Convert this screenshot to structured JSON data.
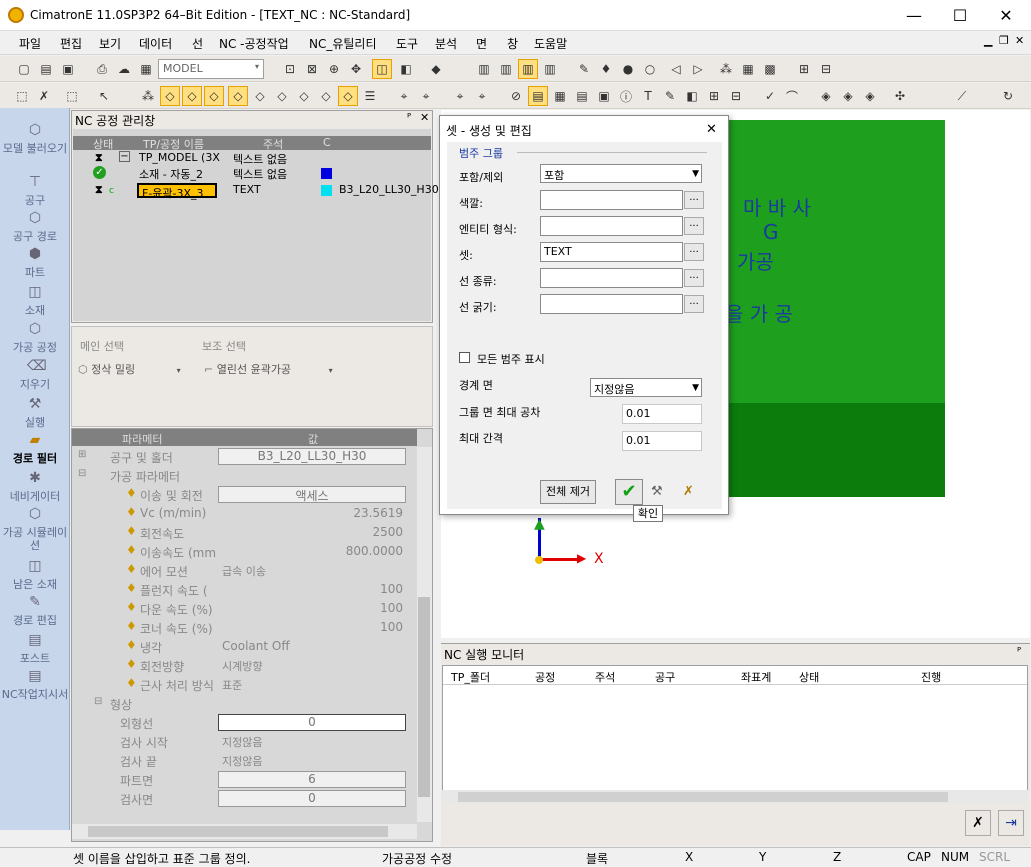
{
  "window": {
    "title": "CimatronE 11.0SP3P2 64–Bit Edition - [TEXT_NC : NC-Standard]",
    "minimize": "—",
    "maximize": "☐",
    "close": "✕"
  },
  "menu": [
    "파일",
    "편집",
    "보기",
    "데이터",
    "선",
    "NC -공정작업",
    "NC_유틸리티",
    "도구",
    "분석",
    "면",
    "창",
    "도움말"
  ],
  "toolbar": {
    "model_combo": "MODEL"
  },
  "sidebar": [
    {
      "label": "모델 불러오기",
      "icon": "model-load-icon"
    },
    {
      "label": "공구",
      "icon": "tool-icon"
    },
    {
      "label": "공구 경로",
      "icon": "toolpath-icon"
    },
    {
      "label": "파트",
      "icon": "part-icon"
    },
    {
      "label": "소재",
      "icon": "stock-icon"
    },
    {
      "label": "가공 공정",
      "icon": "process-icon"
    },
    {
      "label": "지우기",
      "icon": "erase-icon"
    },
    {
      "label": "실행",
      "icon": "run-icon"
    },
    {
      "label": "경로 필터",
      "icon": "path-filter-icon"
    },
    {
      "label": "네비게이터",
      "icon": "navigator-icon"
    },
    {
      "label": "가공 시뮬레이션",
      "icon": "simulation-icon"
    },
    {
      "label": "남은 소재",
      "icon": "remaining-stock-icon"
    },
    {
      "label": "경로 편집",
      "icon": "path-edit-icon"
    },
    {
      "label": "포스트",
      "icon": "post-icon"
    },
    {
      "label": "NC작업지시서",
      "icon": "nc-sheet-icon"
    }
  ],
  "nc_manager": {
    "title": "NC 공정 관리창",
    "pin": "ᴾ",
    "close": "✕",
    "columns": [
      "상태",
      "TP/공정 이름",
      "주석",
      "C"
    ],
    "rows": [
      {
        "name": "TP_MODEL (3X",
        "comment": "텍스트 없음",
        "extra": ""
      },
      {
        "name": "소재 - 자동_2",
        "comment": "텍스트 없음",
        "extra": ""
      },
      {
        "name": "F-윤곽-3X_3",
        "comment": "TEXT",
        "extra": "B3_L20_LL30_H30"
      }
    ],
    "status_c": "c"
  },
  "selection": {
    "main_label": "메인 선택",
    "sub_label": "보조 선택",
    "main_value": "정삭 밀링",
    "sub_value": "열린선 윤곽가공"
  },
  "params": {
    "col_param": "파라메터",
    "col_value": "값",
    "tool_holder": "공구 및 홀더",
    "tool_value": "B3_L20_LL30_H30",
    "machining": "가공 파라메터",
    "rows": [
      {
        "name": "이송 및 회전",
        "value": "액세스"
      },
      {
        "name": "Vc (m/min)",
        "value": "23.5619"
      },
      {
        "name": "회전속도",
        "value": "2500"
      },
      {
        "name": "이송속도 (mm",
        "value": "800.0000"
      },
      {
        "name": "에어 모션",
        "value": "급속 이송"
      },
      {
        "name": "플런지 속도 (",
        "value": "100"
      },
      {
        "name": "다운 속도 (%)",
        "value": "100"
      },
      {
        "name": "코너 속도 (%)",
        "value": "100"
      },
      {
        "name": "냉각",
        "value": "Coolant Off"
      },
      {
        "name": "회전방향",
        "value": "시계방향"
      },
      {
        "name": "근사 처리 방식",
        "value": "표준"
      }
    ],
    "shape": "형상",
    "shape_rows": [
      {
        "name": "외형선",
        "value": "0"
      },
      {
        "name": "검사 시작",
        "value": "지정않음"
      },
      {
        "name": "검사 끝",
        "value": "지정않음"
      },
      {
        "name": "파트면",
        "value": "6"
      },
      {
        "name": "검사면",
        "value": "0"
      }
    ]
  },
  "dialog": {
    "title": "셋 - 생성 및 편집",
    "close": "✕",
    "group": "범주 그룹",
    "include_label": "포함/제외",
    "include_value": "포함",
    "color_label": "색깔:",
    "entity_label": "엔티티 형식:",
    "set_label": "셋:",
    "set_value": "TEXT",
    "linetype_label": "선 종류:",
    "linewidth_label": "선 굵기:",
    "dots": "...",
    "show_all": "모든 범주 표시",
    "boundary_label": "경계 면",
    "boundary_value": "지정않음",
    "group_tol_label": "그룹 면 최대 공차",
    "group_tol_value": "0.01",
    "max_gap_label": "최대 간격",
    "max_gap_value": "0.01",
    "remove_all": "전체 제거",
    "ok": "✔",
    "tooltip": "확인"
  },
  "viewport": {
    "text_line1": "마 바 사",
    "text_line2": "G",
    "text_line3": "가공",
    "text_line4": "을   가 공",
    "axis_x": "X",
    "box_color": "#22a022"
  },
  "monitor": {
    "title": "NC 실행 모니터",
    "columns": [
      "TP_폴더",
      "공정",
      "주석",
      "공구",
      "좌표계",
      "상태",
      "진행"
    ]
  },
  "status": {
    "hint": "셋 이름을 삽입하고 표준 그룹 정의.",
    "mode": "가공공정 수정",
    "block": "블록",
    "x": "X",
    "y": "Y",
    "z": "Z",
    "cap": "CAP",
    "num": "NUM",
    "scrl": "SCRL"
  }
}
